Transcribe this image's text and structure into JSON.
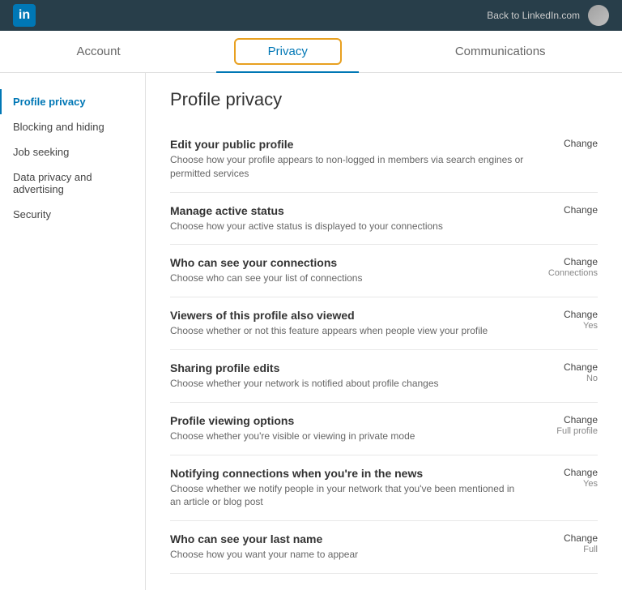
{
  "topbar": {
    "logo": "in",
    "back_link": "Back to LinkedIn.com"
  },
  "nav": {
    "tabs": [
      {
        "id": "account",
        "label": "Account",
        "active": false
      },
      {
        "id": "privacy",
        "label": "Privacy",
        "active": true
      },
      {
        "id": "communications",
        "label": "Communications",
        "active": false
      }
    ]
  },
  "sidebar": {
    "items": [
      {
        "id": "profile-privacy",
        "label": "Profile privacy",
        "active": true
      },
      {
        "id": "blocking-hiding",
        "label": "Blocking and hiding",
        "active": false
      },
      {
        "id": "job-seeking",
        "label": "Job seeking",
        "active": false
      },
      {
        "id": "data-privacy",
        "label": "Data privacy and advertising",
        "active": false
      },
      {
        "id": "security",
        "label": "Security",
        "active": false
      }
    ]
  },
  "content": {
    "page_title": "Profile privacy",
    "settings": [
      {
        "id": "edit-public-profile",
        "title": "Edit your public profile",
        "description": "Choose how your profile appears to non-logged in members via search engines or permitted services",
        "action": "Change",
        "value": ""
      },
      {
        "id": "manage-active-status",
        "title": "Manage active status",
        "description": "Choose how your active status is displayed to your connections",
        "action": "Change",
        "value": ""
      },
      {
        "id": "who-can-see-connections",
        "title": "Who can see your connections",
        "description": "Choose who can see your list of connections",
        "action": "Change",
        "value": "Connections"
      },
      {
        "id": "viewers-also-viewed",
        "title": "Viewers of this profile also viewed",
        "description": "Choose whether or not this feature appears when people view your profile",
        "action": "Change",
        "value": "Yes"
      },
      {
        "id": "sharing-profile-edits",
        "title": "Sharing profile edits",
        "description": "Choose whether your network is notified about profile changes",
        "action": "Change",
        "value": "No"
      },
      {
        "id": "profile-viewing-options",
        "title": "Profile viewing options",
        "description": "Choose whether you're visible or viewing in private mode",
        "action": "Change",
        "value": "Full profile"
      },
      {
        "id": "notifying-connections",
        "title": "Notifying connections when you're in the news",
        "description": "Choose whether we notify people in your network that you've been mentioned in an article or blog post",
        "action": "Change",
        "value": "Yes"
      },
      {
        "id": "who-can-see-last-name",
        "title": "Who can see your last name",
        "description": "Choose how you want your name to appear",
        "action": "Change",
        "value": "Full"
      }
    ]
  }
}
